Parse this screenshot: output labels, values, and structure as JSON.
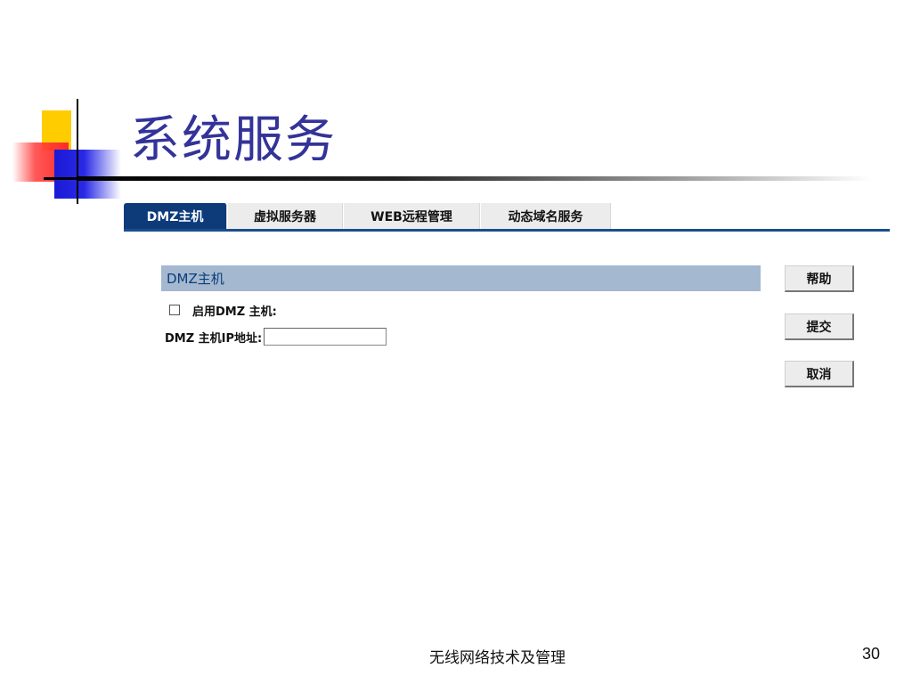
{
  "slide": {
    "title": "系统服务",
    "footer": "无线网络技术及管理",
    "page_number": "30"
  },
  "tabs": [
    {
      "label": "DMZ主机",
      "active": true
    },
    {
      "label": "虚拟服务器",
      "active": false
    },
    {
      "label": "WEB远程管理",
      "active": false
    },
    {
      "label": "动态域名服务",
      "active": false
    }
  ],
  "panel": {
    "header": "DMZ主机",
    "enable_label": "启用DMZ 主机:",
    "enable_checked": false,
    "ip_label": "DMZ 主机IP地址:",
    "ip_value": ""
  },
  "buttons": {
    "help": "帮助",
    "submit": "提交",
    "cancel": "取消"
  },
  "colors": {
    "title": "#333399",
    "tab_active_bg": "#0d3b7a",
    "panel_header_bg": "#a4b8cf",
    "panel_header_text": "#0a3d7a"
  }
}
